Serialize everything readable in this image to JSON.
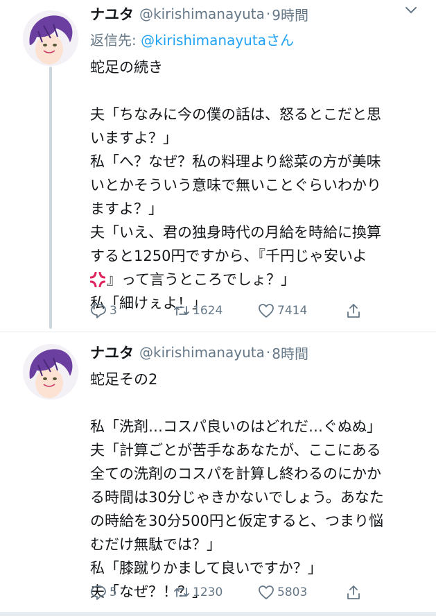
{
  "tweets": [
    {
      "display_name": "ナユタ",
      "handle": "@kirishimanayuta",
      "separator": "·",
      "time": "9時間",
      "reply_prefix": "返信先: ",
      "reply_mention": "@kirishimanayuta",
      "reply_suffix": "さん",
      "lines": [
        "蛇足の続き",
        "",
        "夫「ちなみに今の僕の話は、怒るとこだと思",
        "いますよ？」",
        "私「へ？なぜ？私の料理より総菜の方が美味",
        "いとかそういう意味で無いことぐらいわかり",
        "ますよ？」",
        "夫「いえ、君の独身時代の月給を時給に換算",
        "すると1250円ですから、『千円じゃ安いよ",
        "』って言うところでしょ？」",
        "私「細けぇよ！」"
      ],
      "replies": "3",
      "retweets": "1624",
      "likes": "7414"
    },
    {
      "display_name": "ナユタ",
      "handle": "@kirishimanayuta",
      "separator": "·",
      "time": "8時間",
      "lines": [
        "蛇足その2",
        "",
        "私「洗剤…コスパ良いのはどれだ…ぐぬぬ」",
        "夫「計算ごとが苦手なあなたが、ここにある",
        "全ての洗剤のコスパを計算し終わるのにかか",
        "る時間は30分じゃきかないでしょう。あなた",
        "の時給を30分500円と仮定すると、つまり悩",
        "むだけ無駄では？」",
        "私「膝蹴りかまして良いですか？」",
        "夫「なぜ？！？」"
      ],
      "replies": "5",
      "retweets": "1230",
      "likes": "5803"
    }
  ],
  "icons": {
    "reply": "reply-icon",
    "retweet": "retweet-icon",
    "like": "like-icon",
    "share": "share-icon",
    "caret": "chevron-down-icon",
    "emoji": "anger-symbol-emoji"
  },
  "colors": {
    "text": "#14171a",
    "secondary": "#657786",
    "link": "#1da1f2",
    "divider": "#e6ecf0",
    "thread_line": "#ccd6dd",
    "avatar_hair": "#6b3fa0"
  }
}
